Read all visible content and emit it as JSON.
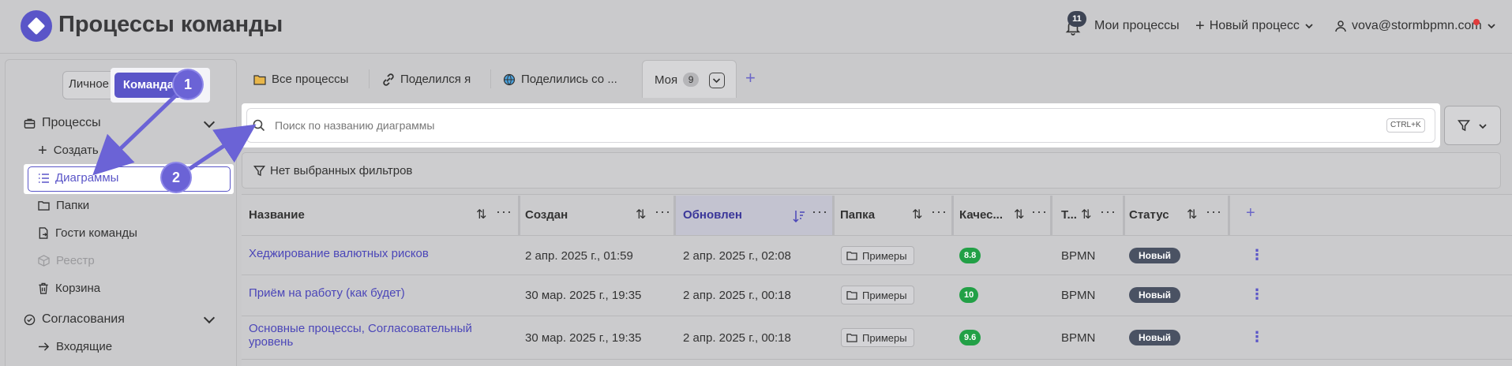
{
  "header": {
    "title": "Процессы команды",
    "notifications_count": "11",
    "my_processes": "Мои процессы",
    "new_process": "Новый процесс",
    "user_email": "vova@stormbpmn.com"
  },
  "sidebar": {
    "segment_personal": "Личное",
    "segment_team": "Команда",
    "sections": [
      {
        "label": "Процессы",
        "items": [
          {
            "label": "Создать"
          },
          {
            "label": "Диаграммы"
          },
          {
            "label": "Папки"
          },
          {
            "label": "Гости команды"
          },
          {
            "label": "Реестр"
          },
          {
            "label": "Корзина"
          }
        ]
      },
      {
        "label": "Согласования",
        "items": [
          {
            "label": "Входящие"
          }
        ]
      }
    ]
  },
  "callouts": [
    "1",
    "2"
  ],
  "tabs": [
    {
      "label": "Все процессы"
    },
    {
      "label": "Поделился я"
    },
    {
      "label": "Поделились со ..."
    },
    {
      "label": "Моя",
      "count": "9"
    }
  ],
  "search": {
    "placeholder": "Поиск по названию диаграммы",
    "shortcut": "CTRL+K"
  },
  "filters": {
    "label": "Нет выбранных фильтров"
  },
  "table": {
    "columns": [
      "Название",
      "Создан",
      "Обновлен",
      "Папка",
      "Качес...",
      "Т...",
      "Статус"
    ],
    "rows": [
      {
        "name": "Хеджирование валютных рисков",
        "created": "2 апр. 2025 г., 01:59",
        "updated": "2 апр. 2025 г., 02:08",
        "folder": "Примеры",
        "quality": "8.8",
        "type": "BPMN",
        "status": "Новый"
      },
      {
        "name": "Приём на работу (как будет)",
        "created": "30 мар. 2025 г., 19:35",
        "updated": "2 апр. 2025 г., 00:18",
        "folder": "Примеры",
        "quality": "10",
        "type": "BPMN",
        "status": "Новый"
      },
      {
        "name_line1": "Основные процессы, Согласовательный",
        "name_line2": "уровень",
        "created": "30 мар. 2025 г., 19:35",
        "updated": "2 апр. 2025 г., 00:18",
        "folder": "Примеры",
        "quality": "9.6",
        "type": "BPMN",
        "status": "Новый"
      }
    ]
  }
}
